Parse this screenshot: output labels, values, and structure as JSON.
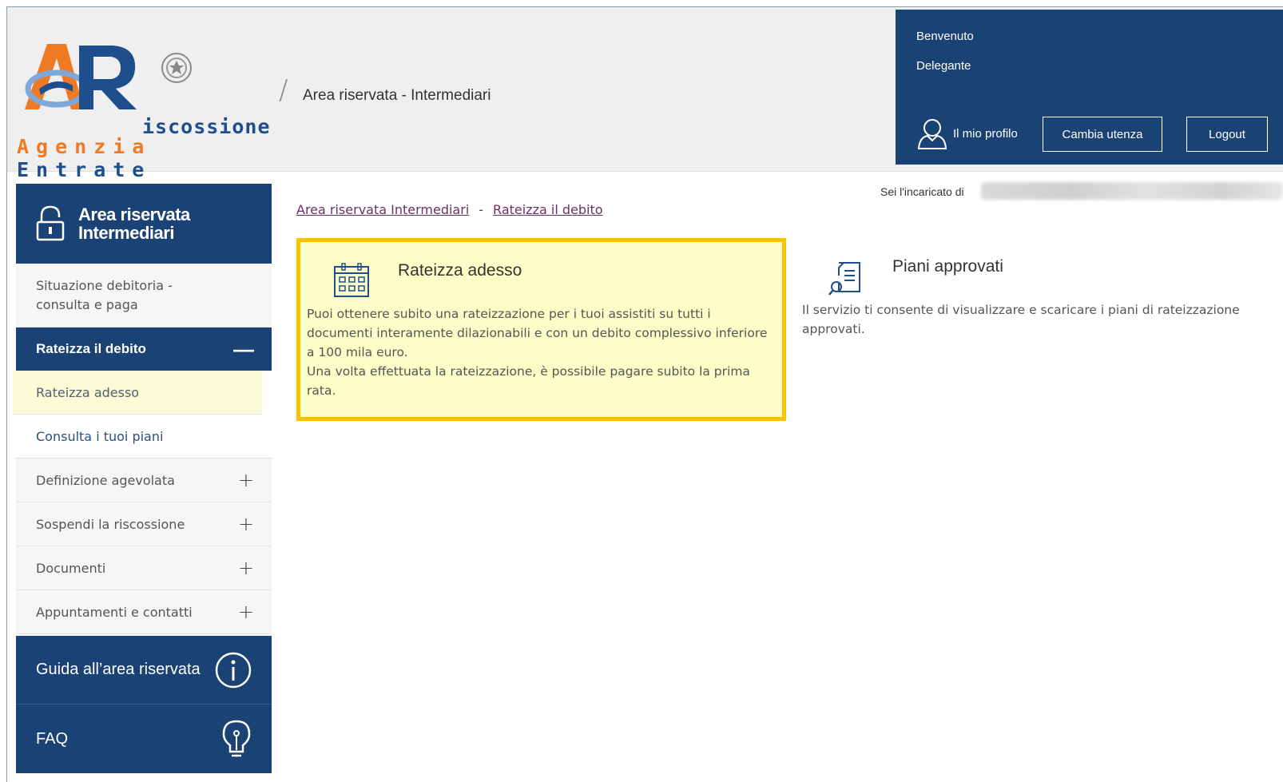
{
  "header": {
    "logo_line1": "iscossione",
    "logo_line2_orange": "Agenzia",
    "logo_line2_blue": "Entrate",
    "area_title": "Area riservata - Intermediari"
  },
  "user_panel": {
    "welcome": "Benvenuto",
    "role": "Delegante",
    "profile_label": "Il mio profilo",
    "switch_user_label": "Cambia utenza",
    "logout_label": "Logout"
  },
  "sidebar": {
    "title_line1": "Area riservata",
    "title_line2": "Intermediari",
    "items": [
      {
        "label_line1": "Situazione debitoria -",
        "label_line2": "consulta e paga"
      },
      {
        "label": "Rateizza il debito"
      },
      {
        "label": "Rateizza adesso"
      },
      {
        "label": "Consulta i tuoi piani"
      },
      {
        "label": "Definizione agevolata"
      },
      {
        "label": "Sospendi la riscossione"
      },
      {
        "label": "Documenti"
      },
      {
        "label": "Appuntamenti e contatti"
      }
    ],
    "guide_label": "Guida all’area riservata",
    "faq_label": "FAQ"
  },
  "main": {
    "assigned_label": "Sei l'incaricato di",
    "breadcrumb": [
      "Area riservata Intermediari",
      "-",
      "Rateizza il debito"
    ],
    "cards": [
      {
        "title": "Rateizza adesso",
        "text_lines": [
          "Puoi ottenere subito una rateizzazione per i tuoi assistiti su tutti i",
          "documenti interamente dilazionabili e con un debito complessivo inferiore",
          "a 100 mila euro.",
          "Una volta effettuata la rateizzazione, è possibile pagare subito la prima",
          "rata."
        ]
      },
      {
        "title": "Piani approvati",
        "text_lines": [
          "Il servizio ti consente di visualizzare e scaricare i piani di rateizzazione",
          "approvati."
        ]
      }
    ]
  },
  "colors": {
    "primary": "#1b4275",
    "highlight_border": "#ffc000",
    "highlight_bg": "#fdfdc8",
    "logo_orange": "#f07a24",
    "link": "#6a2f6b"
  }
}
